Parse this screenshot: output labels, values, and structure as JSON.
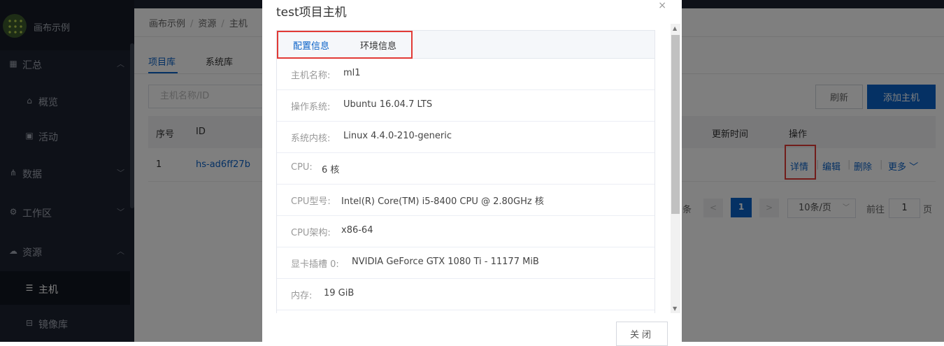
{
  "app": {
    "name": "画布示例"
  },
  "sidebar": {
    "items": [
      {
        "label": "汇总",
        "icon": "grid-icon",
        "chevron": "︿"
      },
      {
        "label": "概览",
        "icon": "home-icon"
      },
      {
        "label": "活动",
        "icon": "calendar-icon"
      },
      {
        "label": "数据",
        "icon": "sitemap-icon",
        "chevron": "﹀"
      },
      {
        "label": "工作区",
        "icon": "gear-icon",
        "chevron": "﹀"
      },
      {
        "label": "资源",
        "icon": "cloud-icon",
        "chevron": "︿"
      },
      {
        "label": "主机",
        "icon": "server-icon"
      },
      {
        "label": "镜像库",
        "icon": "image-repo-icon"
      }
    ]
  },
  "breadcrumb": {
    "items": [
      "画布示例",
      "资源",
      "主机"
    ],
    "separator": "/"
  },
  "tabs": {
    "project": "项目库",
    "system": "系统库"
  },
  "search": {
    "placeholder": "主机名称/ID"
  },
  "toolbar": {
    "refresh": "刷新",
    "add": "添加主机"
  },
  "table": {
    "headers": {
      "no": "序号",
      "id": "ID",
      "updated": "更新时间",
      "ops": "操作"
    },
    "rows": [
      {
        "no": "1",
        "id": "hs-ad6ff27b"
      }
    ],
    "ops": {
      "detail": "详情",
      "edit": "编辑",
      "delete": "删除",
      "more": "更多 ﹀"
    }
  },
  "pagination": {
    "total_suffix": "条",
    "prev": "<",
    "current": "1",
    "next": ">",
    "page_size": "10条/页",
    "goto_prefix": "前往",
    "goto_value": "1",
    "goto_suffix": "页"
  },
  "modal": {
    "title": "test项目主机",
    "close_icon": "×",
    "tabs": {
      "config": "配置信息",
      "env": "环境信息"
    },
    "info": [
      {
        "key": "主机名称:",
        "value": "ml1"
      },
      {
        "key": "操作系统:",
        "value": "Ubuntu 16.04.7 LTS"
      },
      {
        "key": "系统内核:",
        "value": "Linux 4.4.0-210-generic"
      },
      {
        "key": "CPU:",
        "value": "6 核"
      },
      {
        "key": "CPU型号:",
        "value": "Intel(R) Core(TM) i5-8400 CPU @ 2.80GHz 核"
      },
      {
        "key": "CPU架构:",
        "value": "x86-64"
      },
      {
        "key": "显卡插槽 0:",
        "value": "NVIDIA GeForce GTX 1080 Ti - 11177 MiB"
      },
      {
        "key": "内存:",
        "value": "19 GiB"
      }
    ],
    "close_button": "关闭"
  },
  "colors": {
    "accent": "#0a62c8",
    "sidebar_bg": "#1d2330",
    "highlight": "#e23a36"
  }
}
